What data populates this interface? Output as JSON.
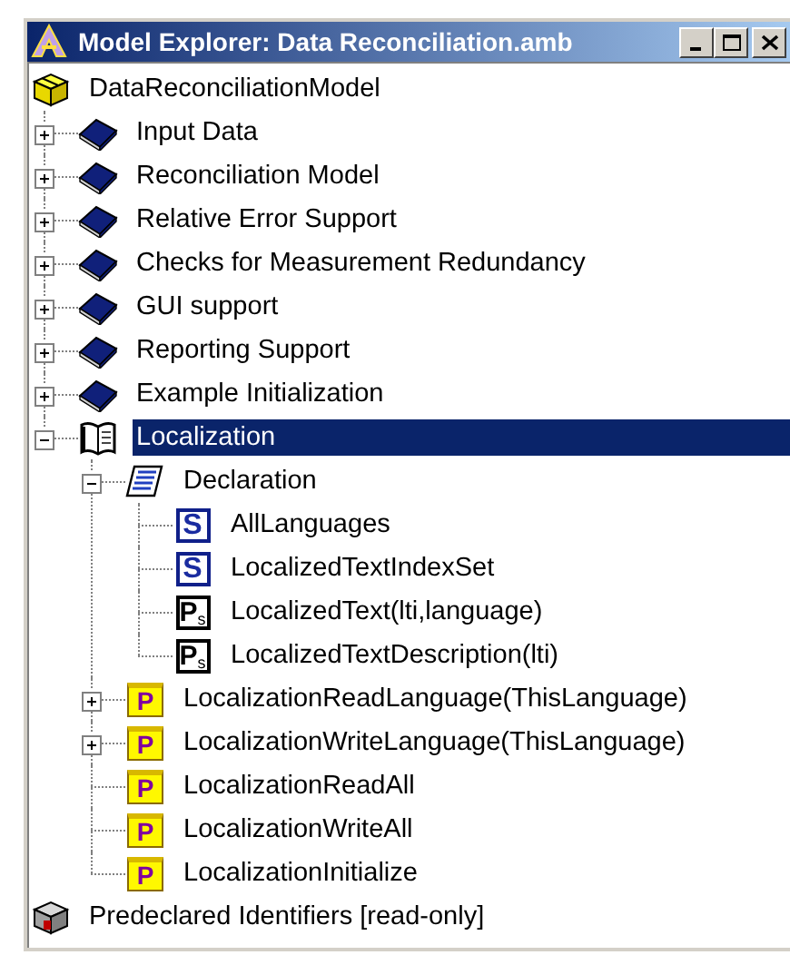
{
  "window": {
    "title": "Model Explorer: Data Reconciliation.amb"
  },
  "tree": [
    {
      "label": "DataReconciliationModel",
      "kind": "model",
      "selected": false,
      "children": [
        {
          "label": "Input Data",
          "kind": "section",
          "selected": false,
          "expanded": false
        },
        {
          "label": "Reconciliation Model",
          "kind": "section",
          "selected": false,
          "expanded": false
        },
        {
          "label": "Relative Error Support",
          "kind": "section",
          "selected": false,
          "expanded": false
        },
        {
          "label": "Checks for Measurement Redundancy",
          "kind": "section",
          "selected": false,
          "expanded": false
        },
        {
          "label": "GUI support",
          "kind": "section",
          "selected": false,
          "expanded": false
        },
        {
          "label": "Reporting Support",
          "kind": "section",
          "selected": false,
          "expanded": false
        },
        {
          "label": "Example Initialization",
          "kind": "section",
          "selected": false,
          "expanded": false
        },
        {
          "label": "Localization",
          "kind": "library",
          "selected": true,
          "expanded": true,
          "children": [
            {
              "label": "Declaration",
              "kind": "declaration",
              "selected": false,
              "expanded": true,
              "children": [
                {
                  "label": "AllLanguages",
                  "kind": "set",
                  "badge": "S",
                  "selected": false
                },
                {
                  "label": "LocalizedTextIndexSet",
                  "kind": "set",
                  "badge": "S",
                  "selected": false
                },
                {
                  "label": "LocalizedText(lti,language)",
                  "kind": "parameter",
                  "badge": "P$_{s}$",
                  "selected": false
                },
                {
                  "label": "LocalizedTextDescription(lti)",
                  "kind": "parameter",
                  "badge": "P$_{s}$",
                  "selected": false
                }
              ]
            },
            {
              "label": "LocalizationReadLanguage(ThisLanguage)",
              "kind": "procedure",
              "badge": "P",
              "selected": false,
              "expanded": false
            },
            {
              "label": "LocalizationWriteLanguage(ThisLanguage)",
              "kind": "procedure",
              "badge": "P",
              "selected": false,
              "expanded": false
            },
            {
              "label": "LocalizationReadAll",
              "kind": "procedure",
              "badge": "P",
              "selected": false
            },
            {
              "label": "LocalizationWriteAll",
              "kind": "procedure",
              "badge": "P",
              "selected": false
            },
            {
              "label": "LocalizationInitialize",
              "kind": "procedure",
              "badge": "P",
              "selected": false
            }
          ]
        }
      ]
    },
    {
      "label": "Predeclared Identifiers [read-only]",
      "kind": "predeclared",
      "selected": false
    }
  ]
}
